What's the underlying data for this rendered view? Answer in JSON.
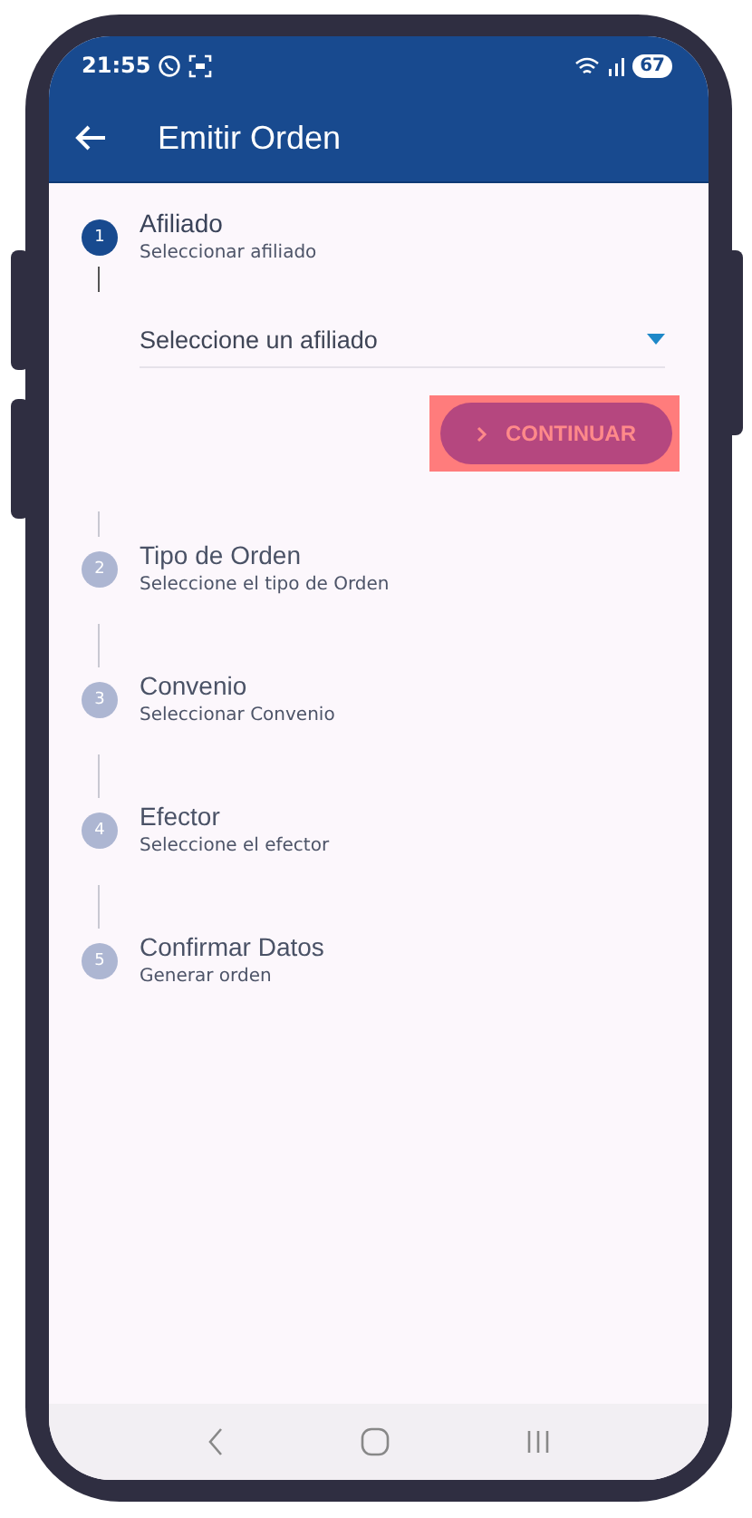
{
  "status_bar": {
    "time": "21:55",
    "battery": "67"
  },
  "app_bar": {
    "title": "Emitir Orden"
  },
  "steps": [
    {
      "number": "1",
      "title": "Afiliado",
      "subtitle": "Seleccionar afiliado",
      "selected": true,
      "field": {
        "placeholder": "Seleccione un afiliado"
      },
      "button": {
        "label": "CONTINUAR",
        "highlighted": true
      }
    },
    {
      "number": "2",
      "title": "Tipo de Orden",
      "subtitle": "Seleccione el tipo de Orden",
      "selected": false
    },
    {
      "number": "3",
      "title": "Convenio",
      "subtitle": "Seleccionar Convenio",
      "selected": false
    },
    {
      "number": "4",
      "title": "Efector",
      "subtitle": "Seleccione el efector",
      "selected": false
    },
    {
      "number": "5",
      "title": "Confirmar Datos",
      "subtitle": "Generar orden",
      "selected": false
    }
  ]
}
